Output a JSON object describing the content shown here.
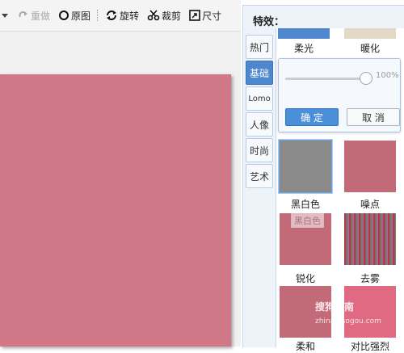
{
  "toolbar": {
    "undo_label": "重做",
    "original_label": "原图",
    "rotate_label": "旋转",
    "crop_label": "裁剪",
    "size_label": "尺寸"
  },
  "panel": {
    "title": "特效：",
    "tabs": [
      {
        "label": "热门"
      },
      {
        "label": "基础"
      },
      {
        "label": "Lomo"
      },
      {
        "label": "人像"
      },
      {
        "label": "时尚"
      },
      {
        "label": "艺术"
      }
    ],
    "active_tab": "基础",
    "top_row": [
      "柔光",
      "暖化"
    ],
    "popup": {
      "slider_value": "100%",
      "confirm_label": "确 定",
      "cancel_label": "取 消"
    },
    "effects": [
      {
        "label": "黑白色",
        "color": "#8a8a8a"
      },
      {
        "label": "噪点",
        "color": "#c26a78"
      },
      {
        "label": "锐化",
        "color": "#c26a78"
      },
      {
        "label": "去雾",
        "color": "#b04a5a"
      },
      {
        "label": "柔和",
        "color": "#c26a78"
      },
      {
        "label": "对比强烈",
        "color": "#e06a82"
      }
    ],
    "tooltip": "黑白色",
    "watermark": "搜狗指南",
    "watermark_url": "zhinan.sogou.com"
  },
  "colors": {
    "accent": "#4a8fd8",
    "photo": "#d07888"
  }
}
